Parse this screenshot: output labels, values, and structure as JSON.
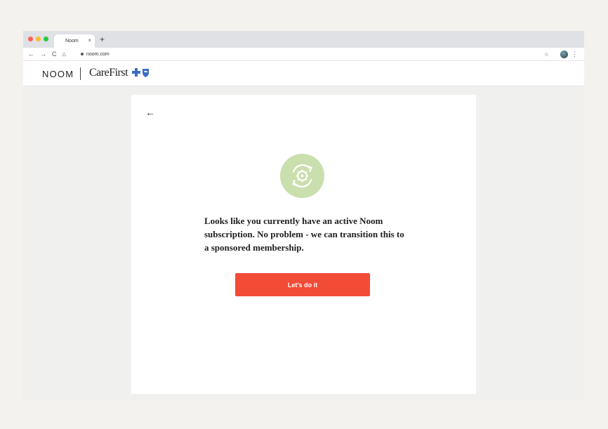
{
  "browser": {
    "tab_title": "Noom",
    "tab_close": "×",
    "new_tab": "+",
    "url": "noom.com",
    "nav": {
      "back": "←",
      "forward": "→",
      "reload": "C",
      "home": "⌂"
    },
    "bookmark": "☆",
    "menu": "⋮"
  },
  "header": {
    "brand": "NOOM",
    "partner": "CareFirst"
  },
  "card": {
    "back": "←",
    "message": "Looks like you currently have an active Noom subscription. No problem - we can transition this to a sponsored membership.",
    "cta_label": "Let's do it"
  },
  "colors": {
    "cta": "#f24b36",
    "icon_circle": "#c9dfad",
    "bcbs_blue": "#3a6fc4"
  }
}
